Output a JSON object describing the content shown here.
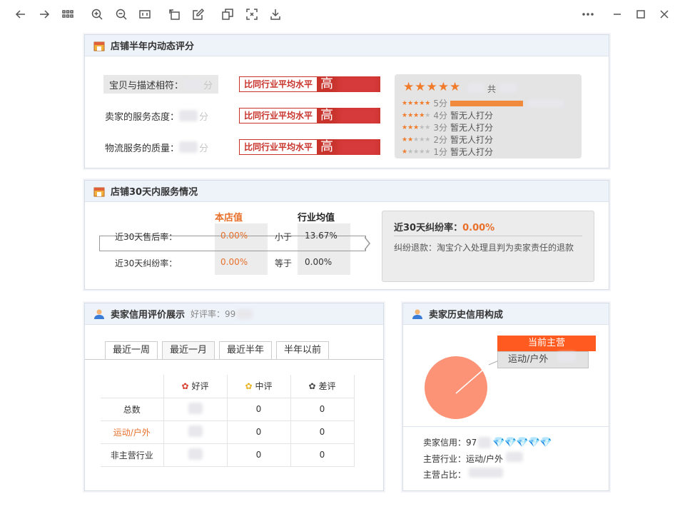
{
  "colors": {
    "accent_red": "#c8332c",
    "orange": "#f07c2b",
    "pie": "#fd9376",
    "current_main": "#ff5a1f",
    "header_bg": "#eef3fa"
  },
  "toolbar": {
    "icons": [
      "arrow-left-icon",
      "arrow-right-icon",
      "grid-icon",
      "zoom-in-icon",
      "zoom-out-icon",
      "fit-width-icon",
      "rotate-icon",
      "edit-icon",
      "copy-icon",
      "fullscreen-icon",
      "download-icon",
      "more-icon",
      "minimize-icon",
      "maximize-icon",
      "close-icon"
    ]
  },
  "dynamic": {
    "title": "店铺半年内动态评分",
    "rows": [
      {
        "label": "宝贝与描述相符：",
        "unit": "分",
        "compare": "比同行业平均水平",
        "level": "高"
      },
      {
        "label": "卖家的服务态度：",
        "unit": "分",
        "compare": "比同行业平均水平",
        "level": "高"
      },
      {
        "label": "物流服务的质量：",
        "unit": "分",
        "compare": "比同行业平均水平",
        "level": "高"
      }
    ],
    "summary_prefix": "共",
    "distribution": [
      {
        "stars": 5,
        "label": "5分",
        "text": "",
        "fill": 1.0
      },
      {
        "stars": 4,
        "label": "4分",
        "text": "暂无人打分",
        "fill": 0
      },
      {
        "stars": 3,
        "label": "3分",
        "text": "暂无人打分",
        "fill": 0
      },
      {
        "stars": 2,
        "label": "2分",
        "text": "暂无人打分",
        "fill": 0
      },
      {
        "stars": 1,
        "label": "1分",
        "text": "暂无人打分",
        "fill": 0
      }
    ]
  },
  "service": {
    "title": "店铺30天内服务情况",
    "col_store": "本店值",
    "col_industry": "行业均值",
    "rows": [
      {
        "label": "近30天售后率：",
        "store": "0.00%",
        "relation": "小于",
        "industry": "13.67%"
      },
      {
        "label": "近30天纠纷率：",
        "store": "0.00%",
        "relation": "等于",
        "industry": "0.00%"
      }
    ],
    "dispute_title": "近30天纠纷率：",
    "dispute_value": "0.00%",
    "dispute_desc": "纠纷退款：淘宝介入处理且判为卖家责任的退款"
  },
  "credit": {
    "title": "卖家信用评价展示",
    "good_rate_label": "好评率：99",
    "tabs": [
      "最近一周",
      "最近一月",
      "最近半年",
      "半年以前"
    ],
    "active_tab": 1,
    "headers": [
      "好评",
      "中评",
      "差评"
    ],
    "rows": [
      {
        "label": "总数",
        "mid": "0",
        "bad": "0"
      },
      {
        "label": "运动/户外",
        "mid": "0",
        "bad": "0"
      },
      {
        "label": "非主营行业",
        "mid": "0",
        "bad": "0"
      }
    ]
  },
  "history": {
    "title": "卖家历史信用构成",
    "current_main": "当前主营",
    "category": "运动/户外",
    "credit_label": "卖家信用：97",
    "industry_label": "主营行业：运动/户外",
    "share_label": "主营占比：",
    "diamonds": 5
  }
}
